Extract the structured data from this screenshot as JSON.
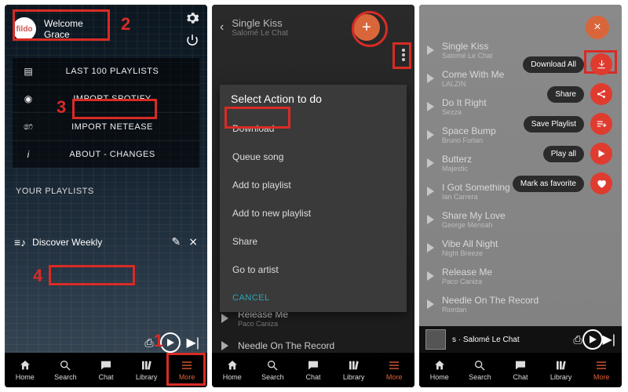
{
  "panel1": {
    "logo_text": "fildo",
    "welcome_line1": "Welcome",
    "welcome_line2": "Grace",
    "menu": [
      {
        "icon": "playlist-icon",
        "label": "LAST 100 PLAYLISTS"
      },
      {
        "icon": "spotify-icon",
        "label": "IMPORT SPOTIFY"
      },
      {
        "icon": "netease-icon",
        "label": "IMPORT NETEASE"
      },
      {
        "icon": "info-icon",
        "label": "ABOUT - CHANGES"
      }
    ],
    "section_header": "YOUR PLAYLISTS",
    "playlist_name": "Discover Weekly",
    "annotations": {
      "n1": "1",
      "n2": "2",
      "n3": "3",
      "n4": "4"
    }
  },
  "panel2": {
    "now_playing_title": "Single Kiss",
    "now_playing_artist": "Salomé Le Chat",
    "sheet_title": "Select Action to do",
    "sheet_items": [
      "Download",
      "Queue song",
      "Add to playlist",
      "Add to new playlist",
      "Share",
      "Go to artist"
    ],
    "cancel": "CANCEL",
    "bg_tracks": [
      {
        "title": "Release Me",
        "artist": "Paco Caniza"
      },
      {
        "title": "Needle On The Record",
        "artist": ""
      }
    ]
  },
  "panel3": {
    "tracks": [
      {
        "title": "Single Kiss",
        "artist": "Salomé Le Chat"
      },
      {
        "title": "Come With Me",
        "artist": "LALZIN"
      },
      {
        "title": "Do It Right",
        "artist": "Sezza"
      },
      {
        "title": "Space Bump",
        "artist": "Bruno Furlan"
      },
      {
        "title": "Butterz",
        "artist": "Majestic"
      },
      {
        "title": "I Got Something",
        "artist": "Ian Carrera"
      },
      {
        "title": "Share My Love",
        "artist": "George Mensah"
      },
      {
        "title": "Vibe All Night",
        "artist": "Night Breeze"
      },
      {
        "title": "Release Me",
        "artist": "Paco Caniza"
      },
      {
        "title": "Needle On The Record",
        "artist": "Riordan"
      }
    ],
    "actions": [
      {
        "label": "Download All",
        "icon": "download-icon",
        "color": "red"
      },
      {
        "label": "Share",
        "icon": "share-icon",
        "color": "red"
      },
      {
        "label": "Save Playlist",
        "icon": "playlist-add-icon",
        "color": "red"
      },
      {
        "label": "Play all",
        "icon": "play-icon",
        "color": "red"
      },
      {
        "label": "Mark as favorite",
        "icon": "heart-icon",
        "color": "red"
      }
    ],
    "miniplayer": "s · Salomé Le Chat"
  },
  "nav": [
    {
      "label": "Home",
      "icon": "home-icon"
    },
    {
      "label": "Search",
      "icon": "search-icon"
    },
    {
      "label": "Chat",
      "icon": "chat-icon"
    },
    {
      "label": "Library",
      "icon": "library-icon"
    },
    {
      "label": "More",
      "icon": "more-icon"
    }
  ]
}
